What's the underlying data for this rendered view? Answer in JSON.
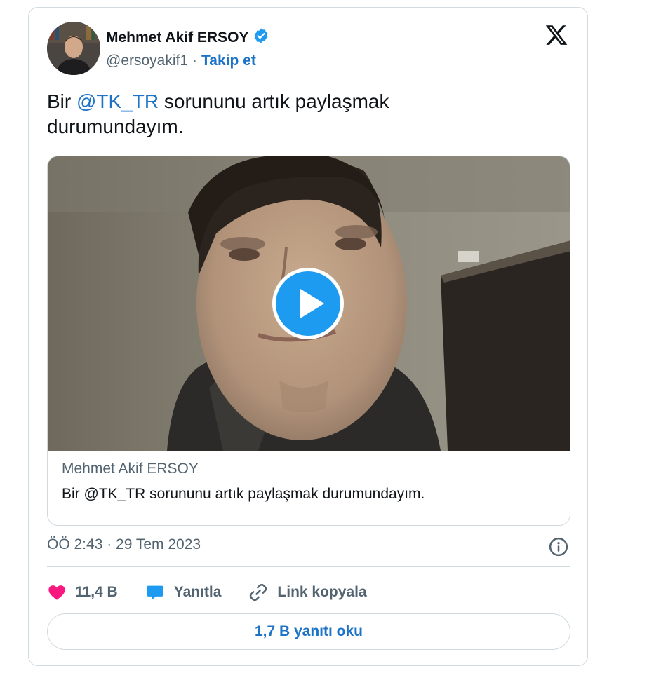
{
  "author": {
    "name": "Mehmet Akif ERSOY",
    "handle": "@ersoyakif1",
    "separator": "·",
    "follow_label": "Takip et",
    "verified": true,
    "verified_color": "#1d9bf0"
  },
  "platform_icon": "x-logo-icon",
  "tweet": {
    "text_before": "Bir ",
    "mention": "@TK_TR",
    "text_after": " sorununu artık paylaşmak durumundayım."
  },
  "media": {
    "type": "video",
    "play_icon": "play-icon",
    "caption_author": "Mehmet Akif ERSOY",
    "caption_text": "Bir @TK_TR sorununu artık paylaşmak durumundayım."
  },
  "meta": {
    "timestamp": "ÖÖ 2:43 · 29 Tem 2023",
    "info_icon": "info-icon"
  },
  "actions": {
    "like_count": "11,4 B",
    "like_icon": "heart-icon",
    "like_color": "#f91880",
    "reply_label": "Yanıtla",
    "reply_icon": "speech-bubble-icon",
    "reply_color": "#1d9bf0",
    "copy_link_label": "Link kopyala",
    "copy_link_icon": "link-icon"
  },
  "read_replies_label": "1,7 B yanıtı oku",
  "colors": {
    "accent": "#1d74c7",
    "secondary_text": "#536471",
    "border": "#cfd9de"
  }
}
